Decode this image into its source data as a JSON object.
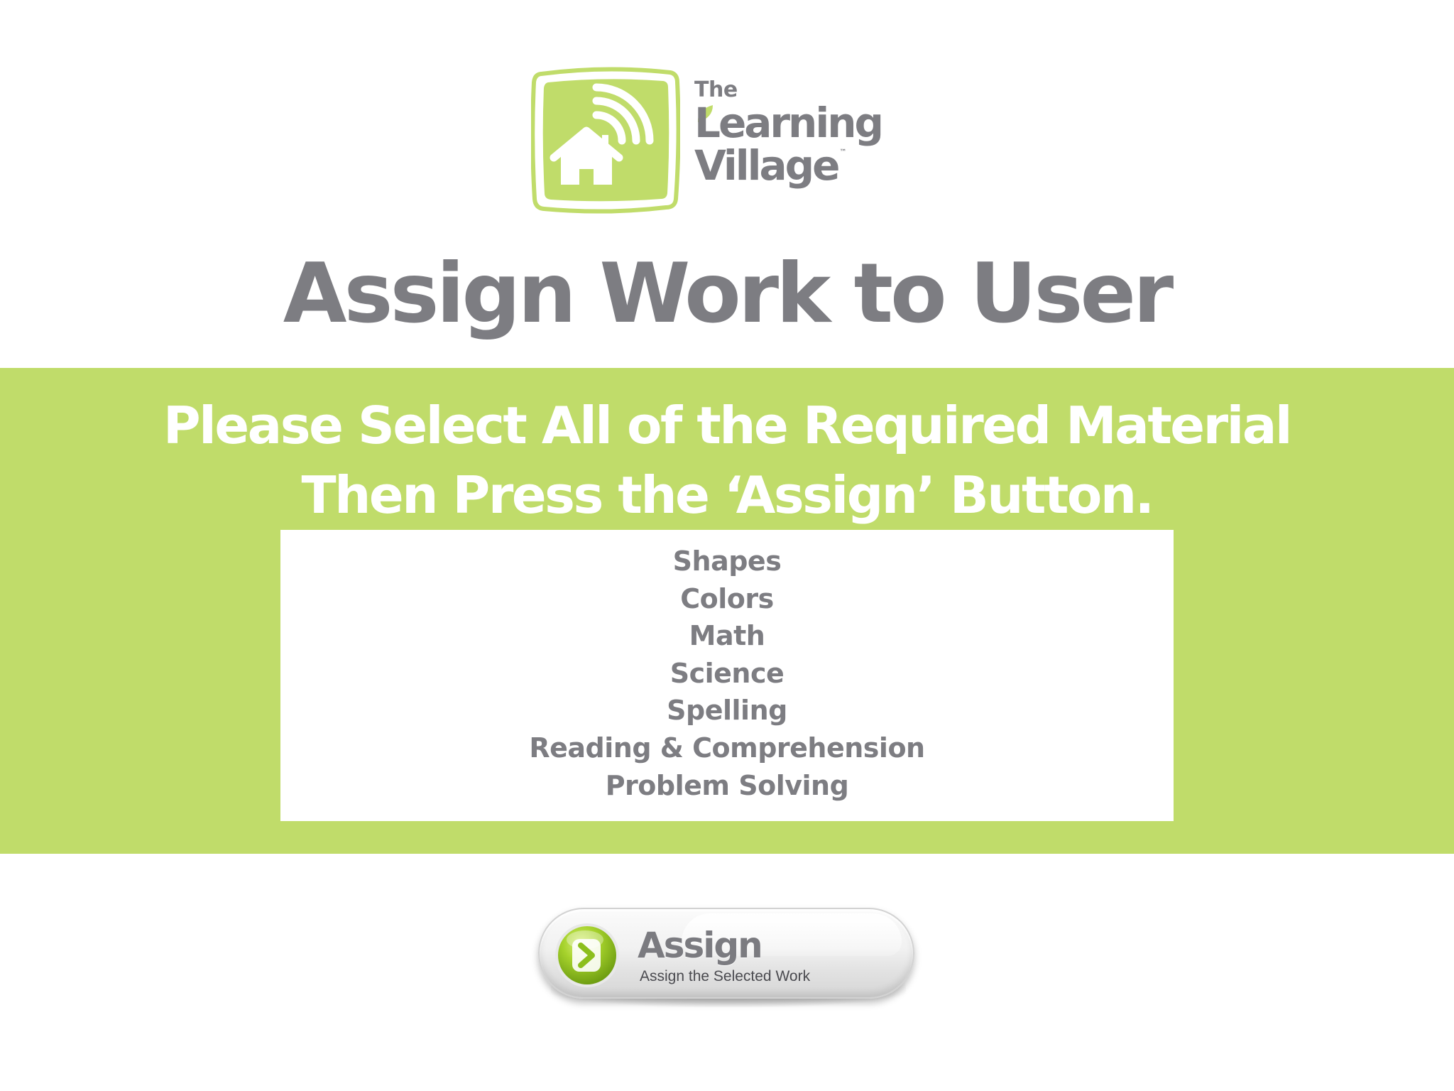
{
  "brand": {
    "the": "The",
    "line1": "Learning",
    "line2": "Village",
    "tm": "™",
    "green": "#c0dc6a",
    "gray": "#7d7d82"
  },
  "page_title": "Assign Work to User",
  "instructions": {
    "line1": "Please Select All of the Required Material",
    "line2": "Then Press the ‘Assign’ Button."
  },
  "materials": [
    "Shapes",
    "Colors",
    "Math",
    "Science",
    "Spelling",
    "Reading & Comprehension",
    "Problem Solving"
  ],
  "assign_button": {
    "label": "Assign",
    "sublabel": "Assign the Selected Work",
    "icon": "chevron-right-icon"
  }
}
